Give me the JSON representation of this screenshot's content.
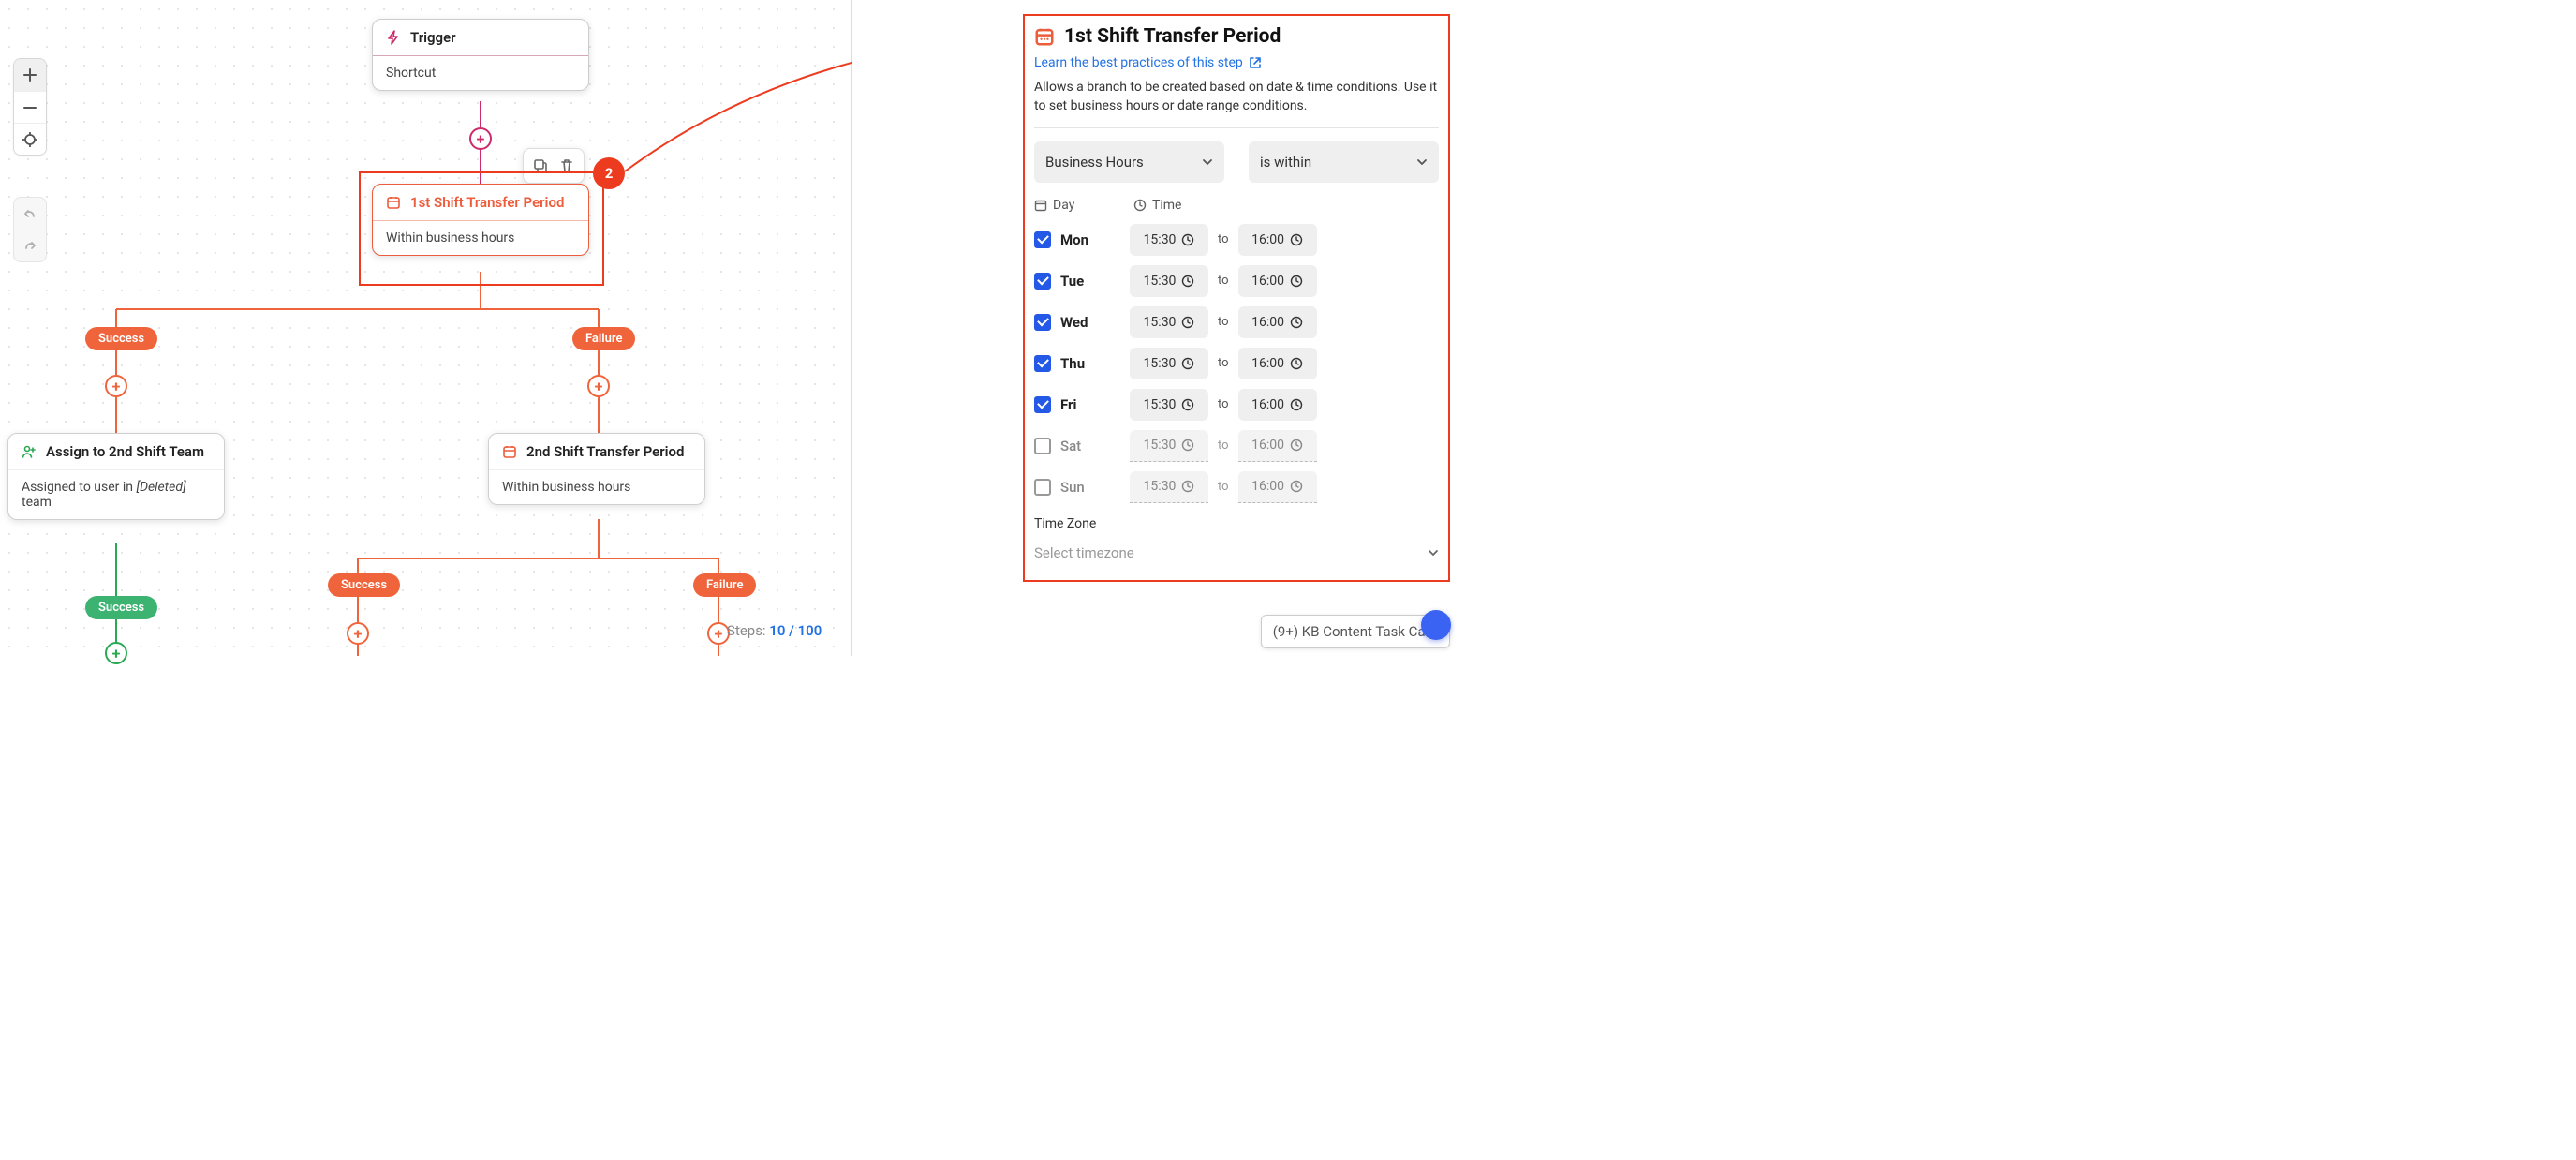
{
  "canvas": {
    "trigger": {
      "title": "Trigger",
      "body": "Shortcut"
    },
    "period1": {
      "title": "1st Shift Transfer Period",
      "body": "Within business hours"
    },
    "assign": {
      "title": "Assign to 2nd Shift Team",
      "body_prefix": "Assigned to user in ",
      "deleted": "[Deleted]",
      "body_suffix": " team"
    },
    "period2": {
      "title": "2nd Shift Transfer Period",
      "body": "Within business hours"
    },
    "pills": {
      "success": "Success",
      "failure": "Failure"
    },
    "steps": {
      "label": "Steps: ",
      "current": "10",
      "sep": " / ",
      "total": "100"
    },
    "selection_badge": "2"
  },
  "panel": {
    "title": "1st Shift Transfer Period",
    "learn_link": "Learn the best practices of this step",
    "desc": "Allows a branch to be created based on date & time conditions. Use it to set business hours or date range conditions.",
    "select_type": "Business Hours",
    "select_cond": "is within",
    "day_header": "Day",
    "time_header": "Time",
    "to_label": "to",
    "days": [
      {
        "name": "Mon",
        "checked": true,
        "from": "15:30",
        "to": "16:00"
      },
      {
        "name": "Tue",
        "checked": true,
        "from": "15:30",
        "to": "16:00"
      },
      {
        "name": "Wed",
        "checked": true,
        "from": "15:30",
        "to": "16:00"
      },
      {
        "name": "Thu",
        "checked": true,
        "from": "15:30",
        "to": "16:00"
      },
      {
        "name": "Fri",
        "checked": true,
        "from": "15:30",
        "to": "16:00"
      },
      {
        "name": "Sat",
        "checked": false,
        "from": "15:30",
        "to": "16:00"
      },
      {
        "name": "Sun",
        "checked": false,
        "from": "15:30",
        "to": "16:00"
      }
    ],
    "tz_label": "Time Zone",
    "tz_placeholder": "Select timezone"
  },
  "taskcard": {
    "label": "(9+) KB Content Task Card"
  }
}
